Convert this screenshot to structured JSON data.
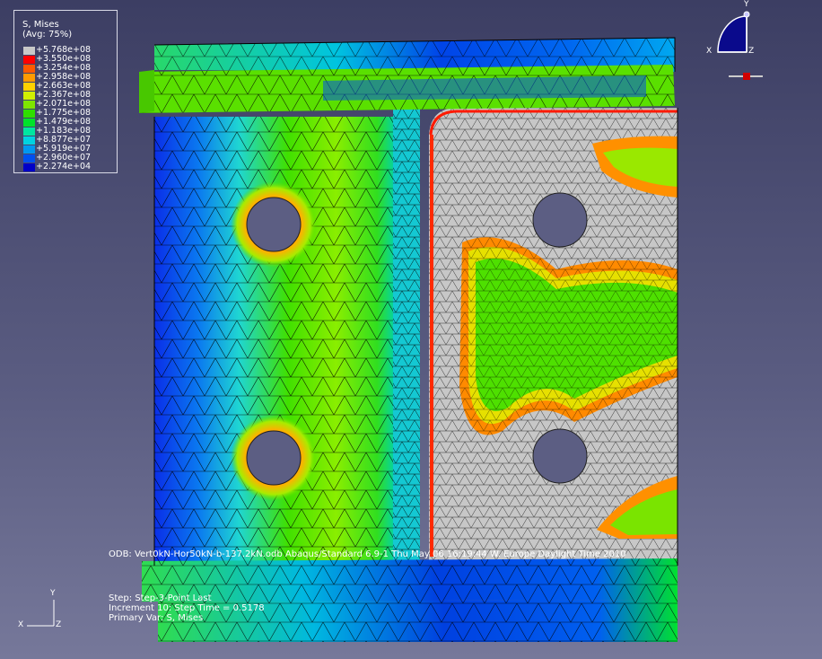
{
  "legend": {
    "title": "S, Mises",
    "subtitle": "(Avg: 75%)",
    "entries": [
      {
        "value": "+5.768e+08",
        "color": "#c8c8c8"
      },
      {
        "value": "+3.550e+08",
        "color": "#ff0000"
      },
      {
        "value": "+3.254e+08",
        "color": "#ff5a00"
      },
      {
        "value": "+2.958e+08",
        "color": "#ff9b00"
      },
      {
        "value": "+2.663e+08",
        "color": "#ffd200"
      },
      {
        "value": "+2.367e+08",
        "color": "#d2f000"
      },
      {
        "value": "+2.071e+08",
        "color": "#7ee600"
      },
      {
        "value": "+1.775e+08",
        "color": "#2fde00"
      },
      {
        "value": "+1.479e+08",
        "color": "#00e22a"
      },
      {
        "value": "+1.183e+08",
        "color": "#00e6a0"
      },
      {
        "value": "+8.877e+07",
        "color": "#00d2e0"
      },
      {
        "value": "+5.919e+07",
        "color": "#0098f0"
      },
      {
        "value": "+2.960e+07",
        "color": "#0050f0"
      },
      {
        "value": "+2.274e+04",
        "color": "#0000c8"
      }
    ]
  },
  "info": {
    "odb_line": "ODB: Vert0kN-Hor50kN-b-137.2kN.odb    Abaqus/Standard 6.9-1    Thu May 06 16:19:44 W. Europe Daylight Time 2010",
    "step_line": "Step: Step-3-Point Last",
    "increment_line": "Increment    10: Step Time =    0.5178",
    "primary_var_line": "Primary Var: S, Mises"
  },
  "triad_top": {
    "y": "Y",
    "x": "X",
    "z": "Z"
  },
  "triad_bottom": {
    "y": "Y",
    "x": "X",
    "z": "Z"
  },
  "colors": {
    "background_top": "#3c3e63",
    "background_bottom": "#76789a",
    "mesh_line": "#000000"
  }
}
